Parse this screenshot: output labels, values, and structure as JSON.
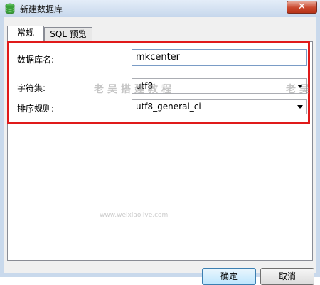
{
  "window": {
    "title": "新建数据库",
    "close_label": "✕"
  },
  "tabs": [
    {
      "label": "常规"
    },
    {
      "label": "SQL 预览"
    }
  ],
  "form": {
    "db_name": {
      "label": "数据库名:",
      "value": "mkcenter"
    },
    "charset": {
      "label": "字符集:",
      "value": "utf8"
    },
    "collation": {
      "label": "排序规则:",
      "value": "utf8_general_ci"
    }
  },
  "buttons": {
    "ok": "确定",
    "cancel": "取消"
  },
  "watermark": {
    "text": "老吴搭建教程",
    "text_right": "老吴",
    "site": "www.weixiaolive.com"
  },
  "colors": {
    "highlight": "#e01a1a",
    "title_icon": "#3aa03a"
  },
  "icons": {
    "title": "database-icon",
    "close": "close-icon",
    "dropdown": "chevron-down-icon"
  }
}
